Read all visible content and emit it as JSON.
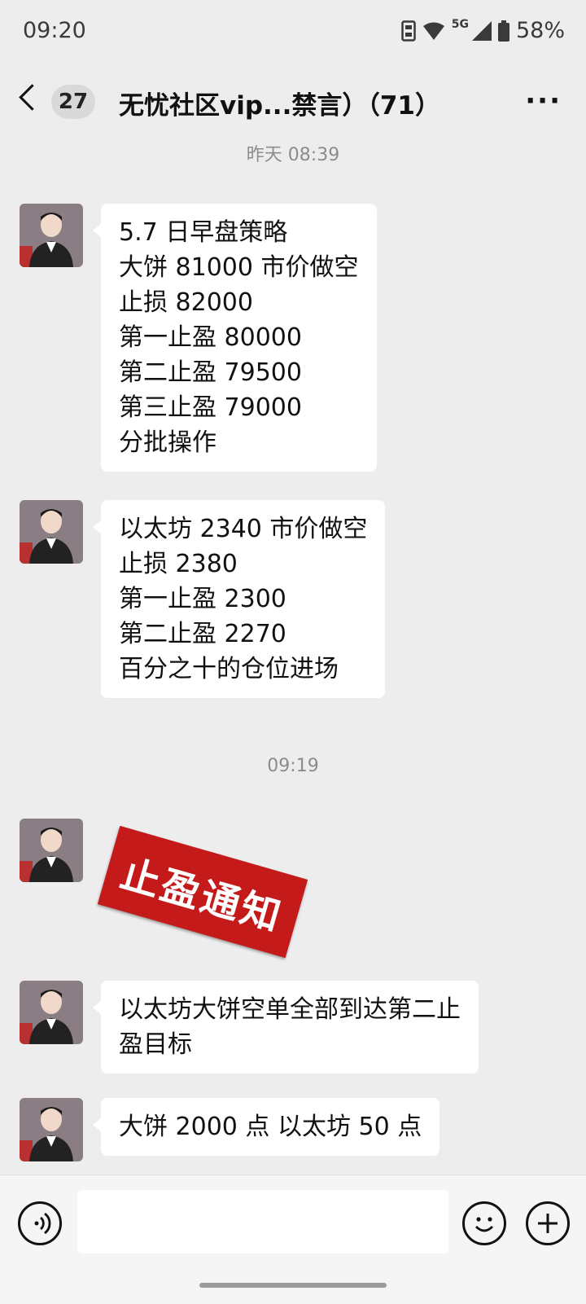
{
  "status_bar": {
    "time": "09:20",
    "network": "5G",
    "battery": "58%",
    "icons": [
      "nfc-icon",
      "wifi-icon",
      "signal-icon",
      "battery-icon"
    ]
  },
  "header": {
    "back_icon": "chevron-left-icon",
    "unread_count": "27",
    "title": "无忧社区vip...禁言）（71）",
    "more_icon": "more-icon"
  },
  "timestamps": {
    "first": "昨天 08:39",
    "second": "09:19"
  },
  "messages": [
    {
      "lines": [
        "5.7 日早盘策略",
        "大饼 81000 市价做空",
        "止损 82000",
        "第一止盈 80000",
        "第二止盈 79500",
        "第三止盈 79000",
        "分批操作"
      ]
    },
    {
      "lines": [
        "以太坊 2340 市价做空",
        "止损 2380",
        "第一止盈 2300",
        "第二止盈 2270",
        "百分之十的仓位进场"
      ]
    },
    {
      "sticker": "止盈通知"
    },
    {
      "lines": [
        "以太坊大饼空单全部到达第二止",
        "盈目标"
      ]
    },
    {
      "lines": [
        "大饼 2000 点 以太坊 50 点"
      ]
    }
  ],
  "input_bar": {
    "voice_icon": "voice-icon",
    "emoji_icon": "emoji-icon",
    "plus_icon": "plus-icon"
  },
  "colors": {
    "background": "#ededed",
    "bubble": "#ffffff",
    "sticker": "#c41a1a"
  }
}
